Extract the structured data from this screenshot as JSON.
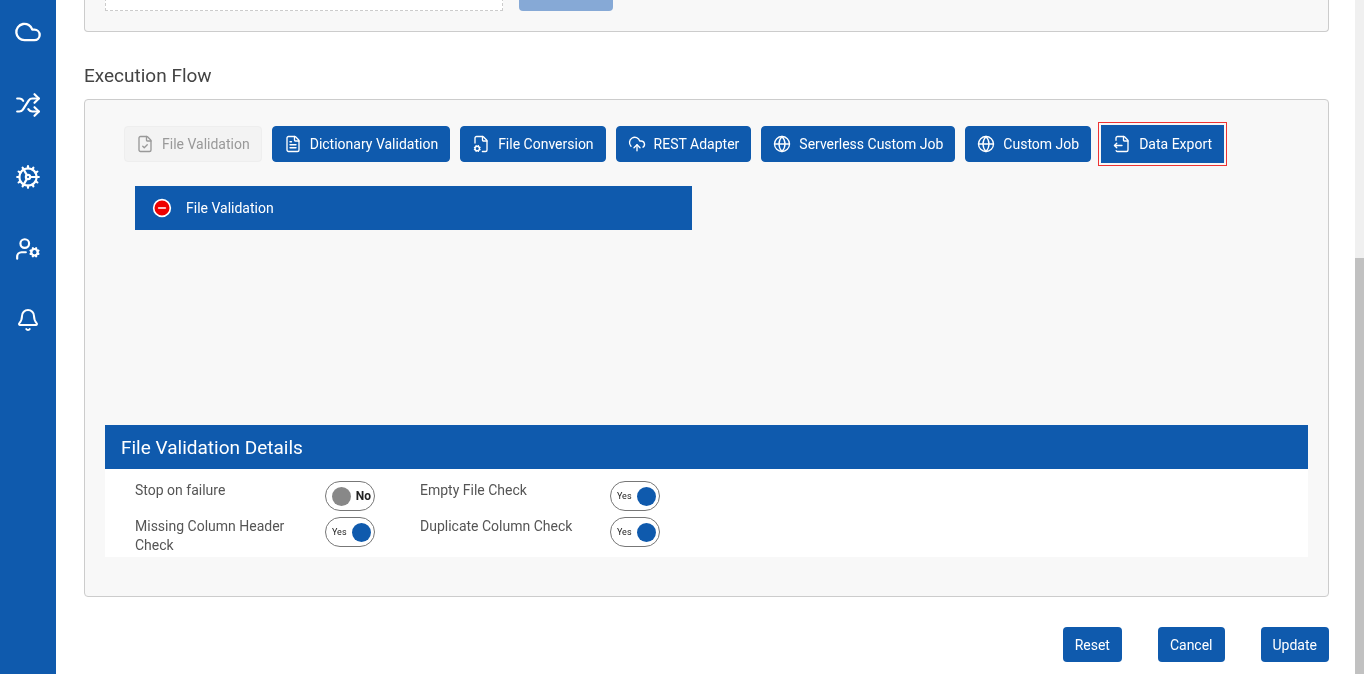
{
  "section_title": "Execution Flow",
  "jobs": [
    {
      "label": "File Validation",
      "kind": "validation",
      "disabled": true,
      "selected": false
    },
    {
      "label": "Dictionary Validation",
      "kind": "dictionary",
      "disabled": false,
      "selected": false
    },
    {
      "label": "File Conversion",
      "kind": "conversion",
      "disabled": false,
      "selected": false
    },
    {
      "label": "REST Adapter",
      "kind": "adapter",
      "disabled": false,
      "selected": false
    },
    {
      "label": "Serverless Custom Job",
      "kind": "custom",
      "disabled": false,
      "selected": false
    },
    {
      "label": "Custom Job",
      "kind": "custom",
      "disabled": false,
      "selected": false
    },
    {
      "label": "Data Export",
      "kind": "export",
      "disabled": false,
      "selected": true
    }
  ],
  "flow_items": [
    {
      "label": "File Validation"
    }
  ],
  "details": {
    "title": "File Validation Details",
    "options": [
      {
        "label": "Stop on failure",
        "on": false,
        "state_text": "No"
      },
      {
        "label": "Empty File Check",
        "on": true,
        "state_text": "Yes"
      },
      {
        "label": "Missing Column Header Check",
        "on": true,
        "state_text": "Yes"
      },
      {
        "label": "Duplicate Column Check",
        "on": true,
        "state_text": "Yes"
      }
    ]
  },
  "actions": [
    "Reset",
    "Cancel",
    "Update"
  ]
}
